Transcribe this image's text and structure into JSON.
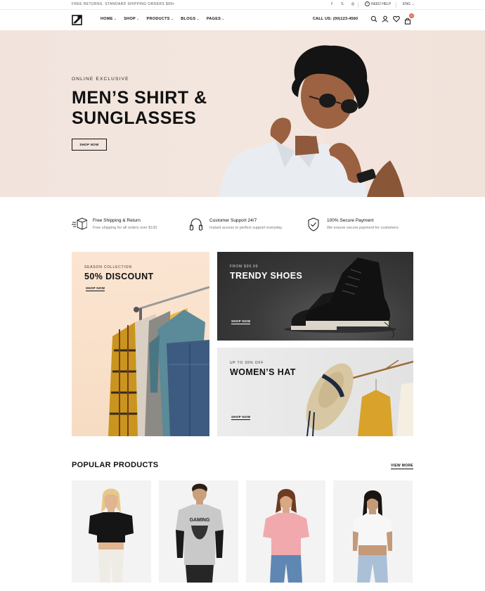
{
  "topbar": {
    "promo": "FREE RETURNS. STANDARD SHIPPING ORDERS $99+",
    "social": [
      "f",
      "𝕏",
      "◎"
    ],
    "help": "NEED HELP",
    "language": "ENG"
  },
  "header": {
    "nav": [
      "HOME",
      "SHOP",
      "PRODUCTS",
      "BLOGS",
      "PAGES"
    ],
    "call": "CALL US: (00)123-4560",
    "cart_count": "0"
  },
  "hero": {
    "eyebrow": "ONLINE EXCLUSIVE",
    "title_line1": "MEN’S SHIRT &",
    "title_line2": "SUNGLASSES",
    "button": "SHOP NOW"
  },
  "features": [
    {
      "icon": "box-shipping-icon",
      "title": "Free Shipping & Return",
      "subtitle": "Free shipping for all orders over $130"
    },
    {
      "icon": "headphones-icon",
      "title": "Customer Support 24/7",
      "subtitle": "Instant access to perfect support everyday"
    },
    {
      "icon": "shield-check-icon",
      "title": "100% Secure Payment",
      "subtitle": "We ensure secure payment for customers"
    }
  ],
  "banners": {
    "season": {
      "eyebrow": "SEASON COLLECTION",
      "title": "50% DISCOUNT",
      "link": "SHOP NOW"
    },
    "shoes": {
      "eyebrow": "FROM $99.99",
      "title": "TRENDY SHOES",
      "link": "SHOP NOW"
    },
    "hat": {
      "eyebrow": "UP TO 30% OFF",
      "title": "WOMEN’S HAT",
      "link": "SHOP NOW"
    }
  },
  "popular": {
    "title": "POPULAR PRODUCTS",
    "view_more": "VIEW MORE",
    "shirt_print": "GAMING"
  },
  "colors": {
    "accent": "#e2674a",
    "hero_bg": "#f2e4dd",
    "season_bg": "#f8e1cc",
    "shoes_bg": "#3a3a3a",
    "hat_bg": "#e6e6e6"
  }
}
